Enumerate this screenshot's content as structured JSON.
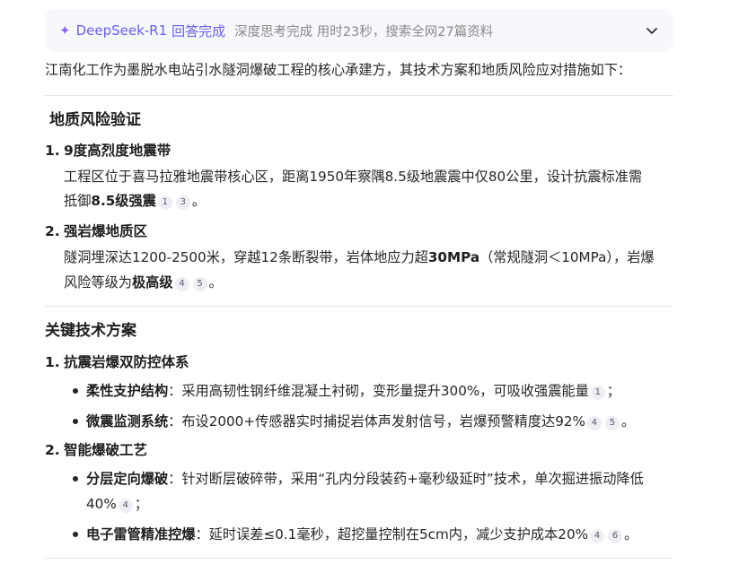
{
  "banner": {
    "icon": "sparkle-icon",
    "model": "DeepSeek-R1",
    "status": "回答完成",
    "detail": "深度思考完成 用时23秒，搜索全网27篇资料",
    "toggle_icon": "chevron-down-icon",
    "accent": "#6a5cf0"
  },
  "intro": "江南化工作为墨脱水电站引水隧洞爆破工程的核心承建方，其技术方案和地质风险应对措施如下：",
  "section1": {
    "heading": "地质风险验证",
    "item1": {
      "num": "1.",
      "title": "9度高烈度地震带",
      "line1": "工程区位于喜马拉雅地震带核心区，距离1950年察隅8.5级地震震中仅80公里，设计抗震标准需",
      "line2_pre": "抵御",
      "line2_bold": "8.5级强震",
      "cites": [
        "1",
        "3"
      ],
      "end": "。"
    },
    "item2": {
      "num": "2.",
      "title": "强岩爆地质区",
      "line1_pre": "隧洞埋深达1200-2500米，穿越12条断裂带，岩体地应力超",
      "line1_bold": "30MPa",
      "line1_post": "（常规隧洞＜10MPa），岩爆",
      "line2_pre": "风险等级为",
      "line2_bold": "极高级",
      "cites": [
        "4",
        "5"
      ],
      "end": "。"
    }
  },
  "section2": {
    "heading": "关键技术方案",
    "item1": {
      "num": "1.",
      "title": "抗震岩爆双防控体系",
      "b1": {
        "label": "柔性支护结构",
        "text": "：采用高韧性钢纤维混凝土衬砌，变形量提升300%，可吸收强震能量",
        "cites": [
          "1"
        ],
        "end": "；"
      },
      "b2": {
        "label": "微震监测系统",
        "text": "：布设2000+传感器实时捕捉岩体声发射信号，岩爆预警精度达92%",
        "cites": [
          "4",
          "5"
        ],
        "end": "。"
      }
    },
    "item2": {
      "num": "2.",
      "title": "智能爆破工艺",
      "b1": {
        "label": "分层定向爆破",
        "text": "：针对断层破碎带，采用“孔内分段装药+毫秒级延时”技术，单次掘进振动降低",
        "line2": "40%",
        "cites": [
          "4"
        ],
        "end": "；"
      },
      "b2": {
        "label": "电子雷管精准控爆",
        "text": "：延时误差≤0.1毫秒，超挖量控制在5cm内，减少支护成本20%",
        "cites": [
          "4",
          "6"
        ],
        "end": "。"
      }
    }
  }
}
